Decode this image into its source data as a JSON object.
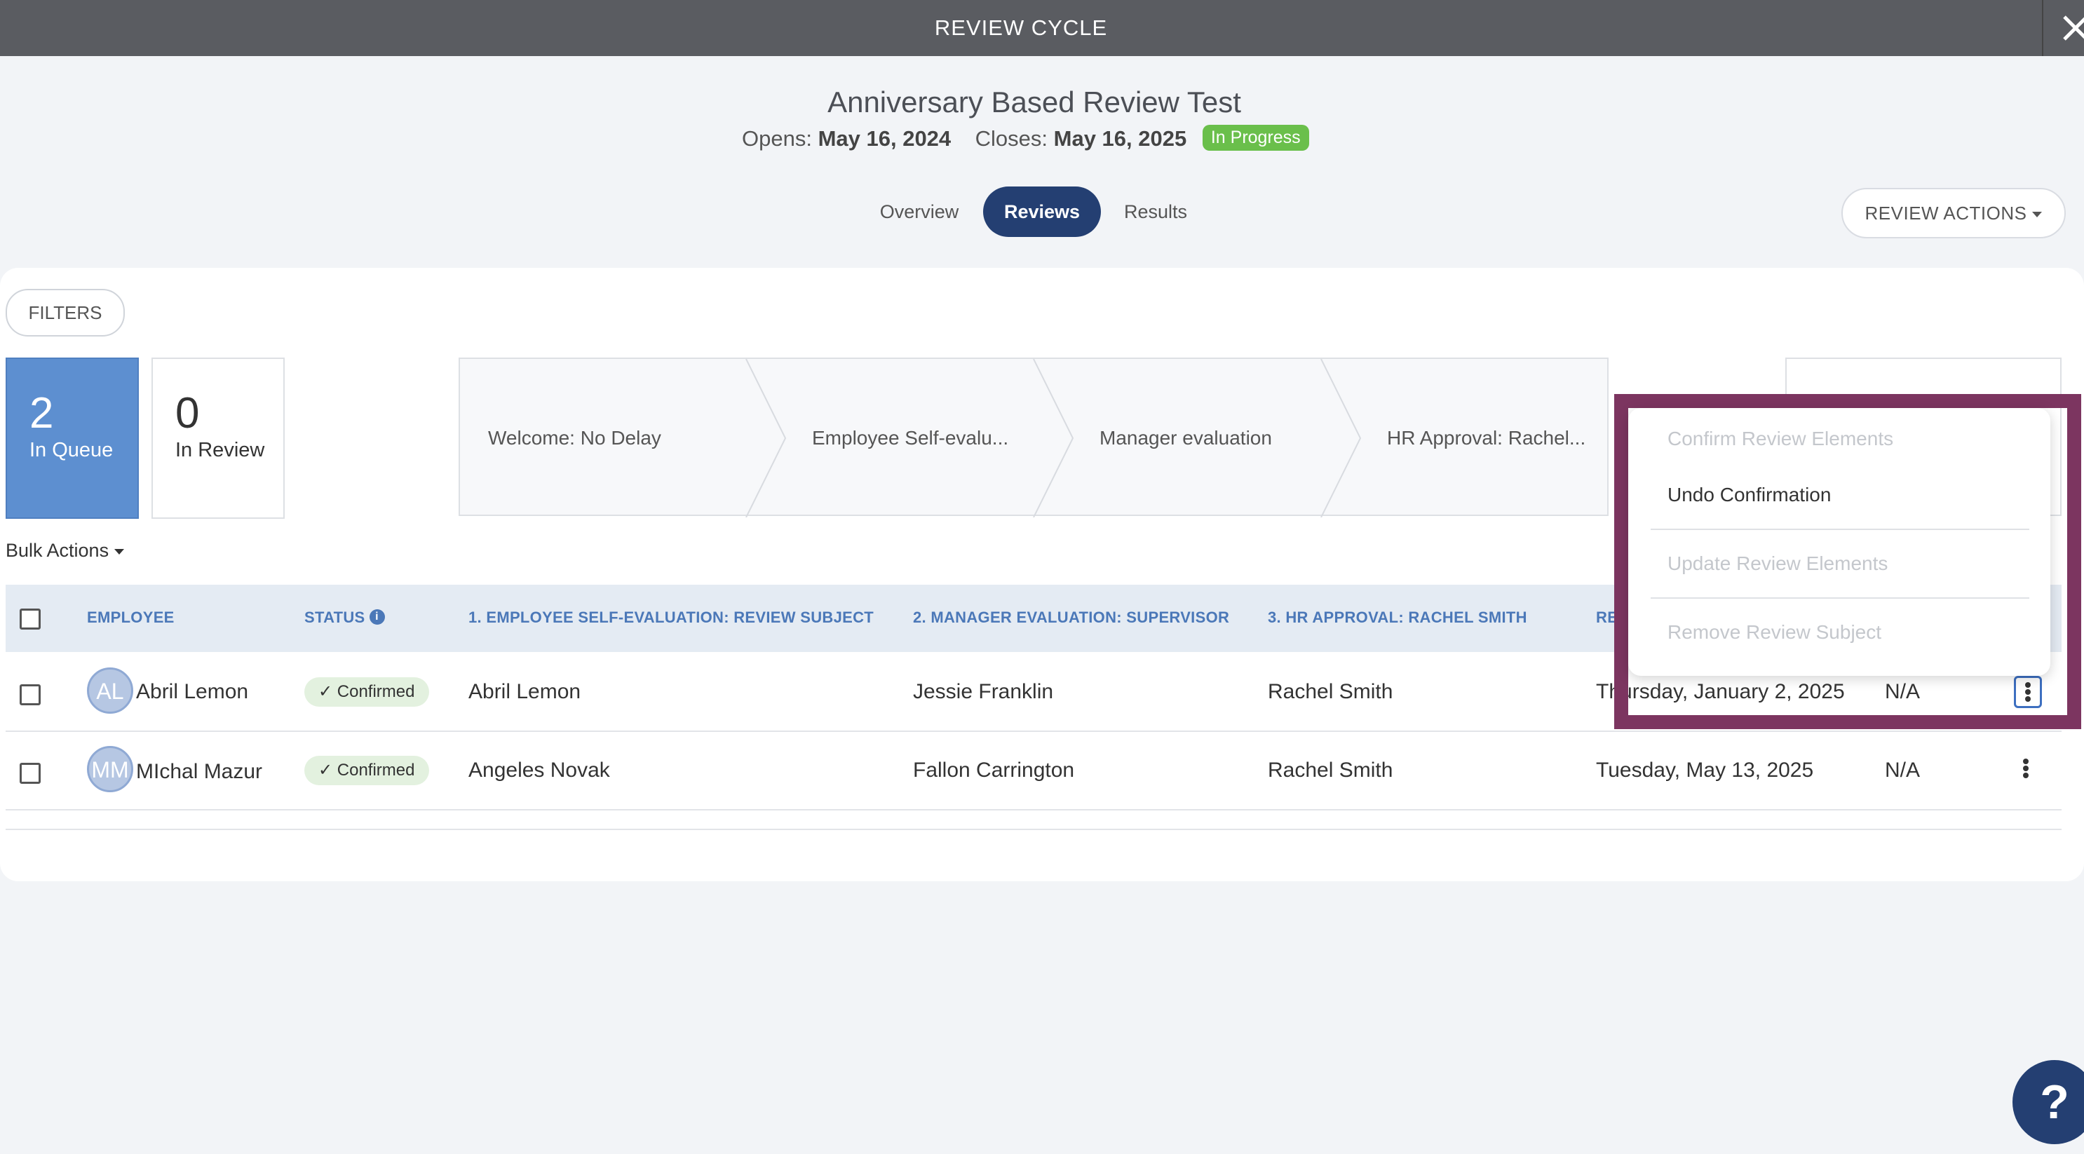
{
  "header": {
    "title": "REVIEW CYCLE"
  },
  "cycle": {
    "name": "Anniversary Based Review Test",
    "opens_label": "Opens:",
    "opens_date": "May 16, 2024",
    "closes_label": "Closes:",
    "closes_date": "May 16, 2025",
    "status": "In Progress"
  },
  "tabs": [
    {
      "label": "Overview",
      "active": false
    },
    {
      "label": "Reviews",
      "active": true
    },
    {
      "label": "Results",
      "active": false
    }
  ],
  "review_actions_label": "REVIEW ACTIONS",
  "filters_label": "FILTERS",
  "stats": {
    "queue": {
      "count": "2",
      "label": "In Queue"
    },
    "review": {
      "count": "0",
      "label": "In Review"
    }
  },
  "stages": [
    "Welcome: No Delay",
    "Employee Self-evalu...",
    "Manager evaluation",
    "HR Approval: Rachel..."
  ],
  "bulk_actions_label": "Bulk Actions",
  "table": {
    "headers": {
      "employee": "EMPLOYEE",
      "status": "STATUS",
      "col1": "1. EMPLOYEE SELF-EVALUATION: REVIEW SUBJECT",
      "col2": "2. MANAGER EVALUATION: SUPERVISOR",
      "col3": "3. HR APPROVAL: RACHEL SMITH",
      "col4": "RE"
    },
    "rows": [
      {
        "initials": "AL",
        "name": "Abril Lemon",
        "status": "Confirmed",
        "self_eval": "Abril Lemon",
        "manager": "Jessie Franklin",
        "hr": "Rachel Smith",
        "date_prefix": "Th",
        "date_rest": "ursday, January 2, 2025",
        "extra": "N/A"
      },
      {
        "initials": "MM",
        "name": "MIchal Mazur",
        "status": "Confirmed",
        "self_eval": "Angeles Novak",
        "manager": "Fallon Carrington",
        "hr": "Rachel Smith",
        "date_prefix": "",
        "date_rest": "Tuesday, May 13, 2025",
        "extra": "N/A"
      }
    ]
  },
  "context_menu": {
    "items": [
      {
        "label": "Confirm Review Elements",
        "enabled": false
      },
      {
        "label": "Undo Confirmation",
        "enabled": true
      },
      {
        "label": "Update Review Elements",
        "enabled": false
      },
      {
        "label": "Remove Review Subject",
        "enabled": false
      }
    ]
  },
  "help_label": "?",
  "colors": {
    "primary": "#243f72",
    "queue_card": "#5d8fd0",
    "header_text": "#4b78b8",
    "in_progress": "#6abf4b",
    "highlight": "#7c3560"
  }
}
